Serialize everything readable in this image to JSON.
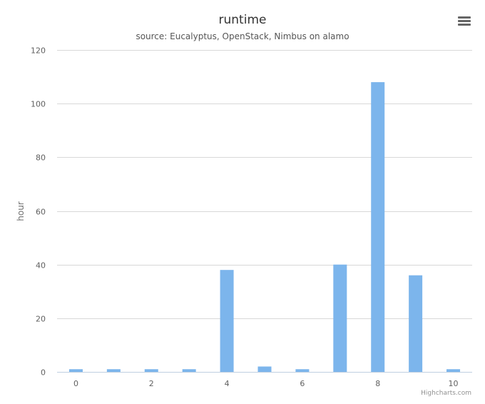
{
  "chart_data": {
    "type": "bar",
    "title": "runtime",
    "subtitle": "source: Eucalyptus, OpenStack, Nimbus on alamo",
    "xlabel": "",
    "ylabel": "hour",
    "x": [
      0,
      1,
      2,
      3,
      4,
      5,
      6,
      7,
      8,
      9,
      10
    ],
    "values": [
      1,
      1,
      1,
      1,
      38,
      2,
      1,
      40,
      108,
      36,
      1
    ],
    "xlim": [
      -0.5,
      10.5
    ],
    "x_ticks": [
      0,
      2,
      4,
      6,
      8,
      10
    ],
    "ylim": [
      0,
      120
    ],
    "y_ticks": [
      0,
      20,
      40,
      60,
      80,
      100,
      120
    ],
    "grid": true,
    "legend": "none",
    "bar_color": "#7cb5ec"
  },
  "credits": "Highcharts.com",
  "export_menu_icon": "hamburger-menu-icon"
}
